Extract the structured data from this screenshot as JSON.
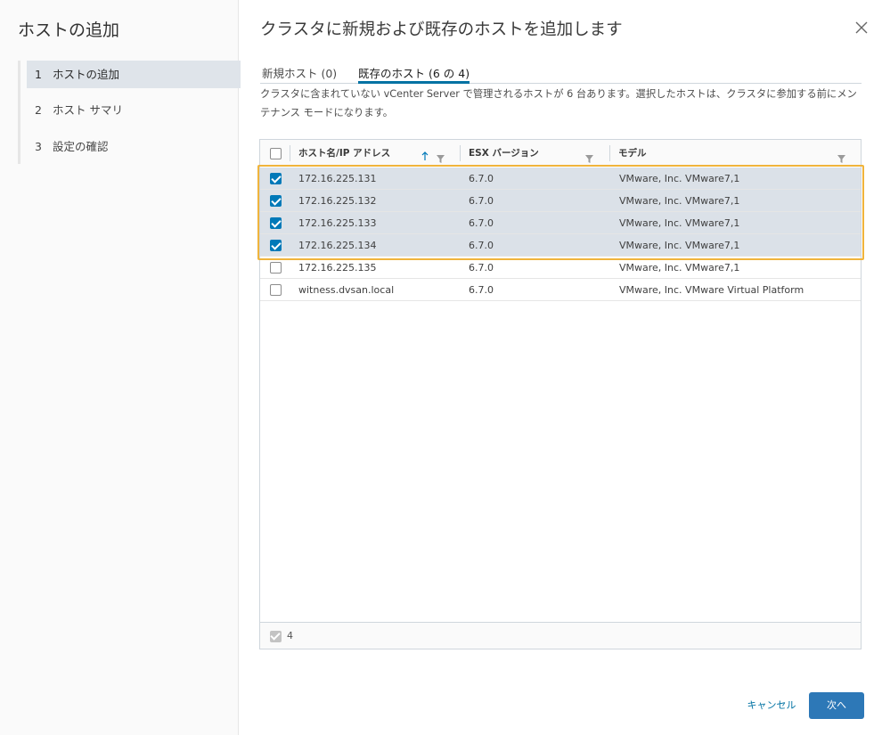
{
  "nav": {
    "title": "ホストの追加",
    "steps": [
      {
        "num": "1",
        "label": "ホストの追加"
      },
      {
        "num": "2",
        "label": "ホスト サマリ"
      },
      {
        "num": "3",
        "label": "設定の確認"
      }
    ]
  },
  "main": {
    "title": "クラスタに新規および既存のホストを追加します",
    "tabs": [
      {
        "label": "新規ホスト (0)"
      },
      {
        "label": "既存のホスト (6 の 4)"
      }
    ],
    "description": "クラスタに含まれていない vCenter Server で管理されるホストが 6 台あります。選択したホストは、クラスタに参加する前にメンテナンス モードになります。"
  },
  "grid": {
    "columns": [
      "ホスト名/IP アドレス",
      "ESX バージョン",
      "モデル"
    ],
    "rows": [
      {
        "host": "172.16.225.131",
        "version": "6.7.0",
        "model": "VMware, Inc. VMware7,1",
        "checked": true
      },
      {
        "host": "172.16.225.132",
        "version": "6.7.0",
        "model": "VMware, Inc. VMware7,1",
        "checked": true
      },
      {
        "host": "172.16.225.133",
        "version": "6.7.0",
        "model": "VMware, Inc. VMware7,1",
        "checked": true
      },
      {
        "host": "172.16.225.134",
        "version": "6.7.0",
        "model": "VMware, Inc. VMware7,1",
        "checked": true
      },
      {
        "host": "172.16.225.135",
        "version": "6.7.0",
        "model": "VMware, Inc. VMware7,1",
        "checked": false
      },
      {
        "host": "witness.dvsan.local",
        "version": "6.7.0",
        "model": "VMware, Inc. VMware Virtual Platform",
        "checked": false
      }
    ],
    "selected_count": "4"
  },
  "buttons": {
    "cancel": "キャンセル",
    "next": "次へ"
  },
  "colors": {
    "accent": "#0079b8",
    "primary_button": "#2d78b7",
    "selected_row": "#dbe1e8",
    "highlight_border": "#f0b43c"
  }
}
